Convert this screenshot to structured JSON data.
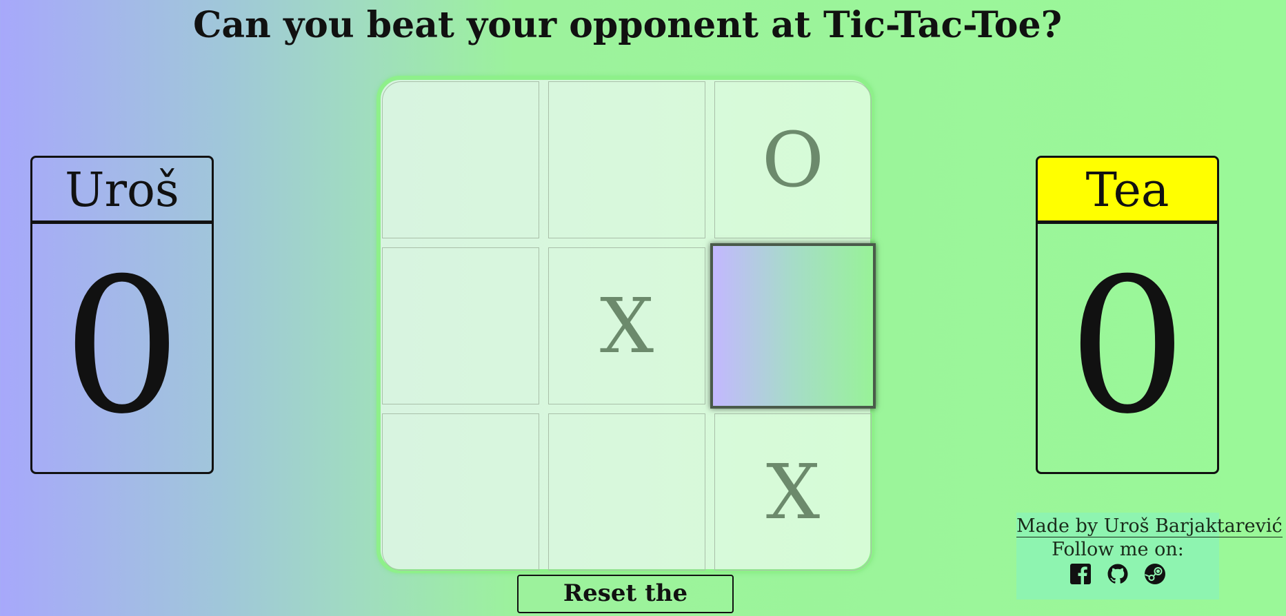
{
  "header": {
    "title": "Can you beat your opponent at Tic-Tac-Toe?"
  },
  "players": {
    "left": {
      "name": "Uroš",
      "score": "0"
    },
    "right": {
      "name": "Tea",
      "score": "0",
      "highlight_color": "#ffff00"
    }
  },
  "board": {
    "cells": [
      [
        "",
        "",
        "O"
      ],
      [
        "",
        "X",
        ""
      ],
      [
        "",
        "",
        "X"
      ]
    ],
    "hovered_cell": "r1c2"
  },
  "controls": {
    "reset_label": "Reset the session!"
  },
  "credits": {
    "made_by": "Made by Uroš Barjaktarević",
    "follow": "Follow me on:",
    "social": [
      {
        "icon": "facebook-icon"
      },
      {
        "icon": "github-icon"
      },
      {
        "icon": "steam-icon"
      }
    ]
  },
  "colors": {
    "background_left": "#a7a8fb",
    "background_right": "#9af898",
    "board_border": "#8ef08a",
    "mark_color": "#6c8a6c",
    "credits_bg": "#8ef4b0"
  }
}
